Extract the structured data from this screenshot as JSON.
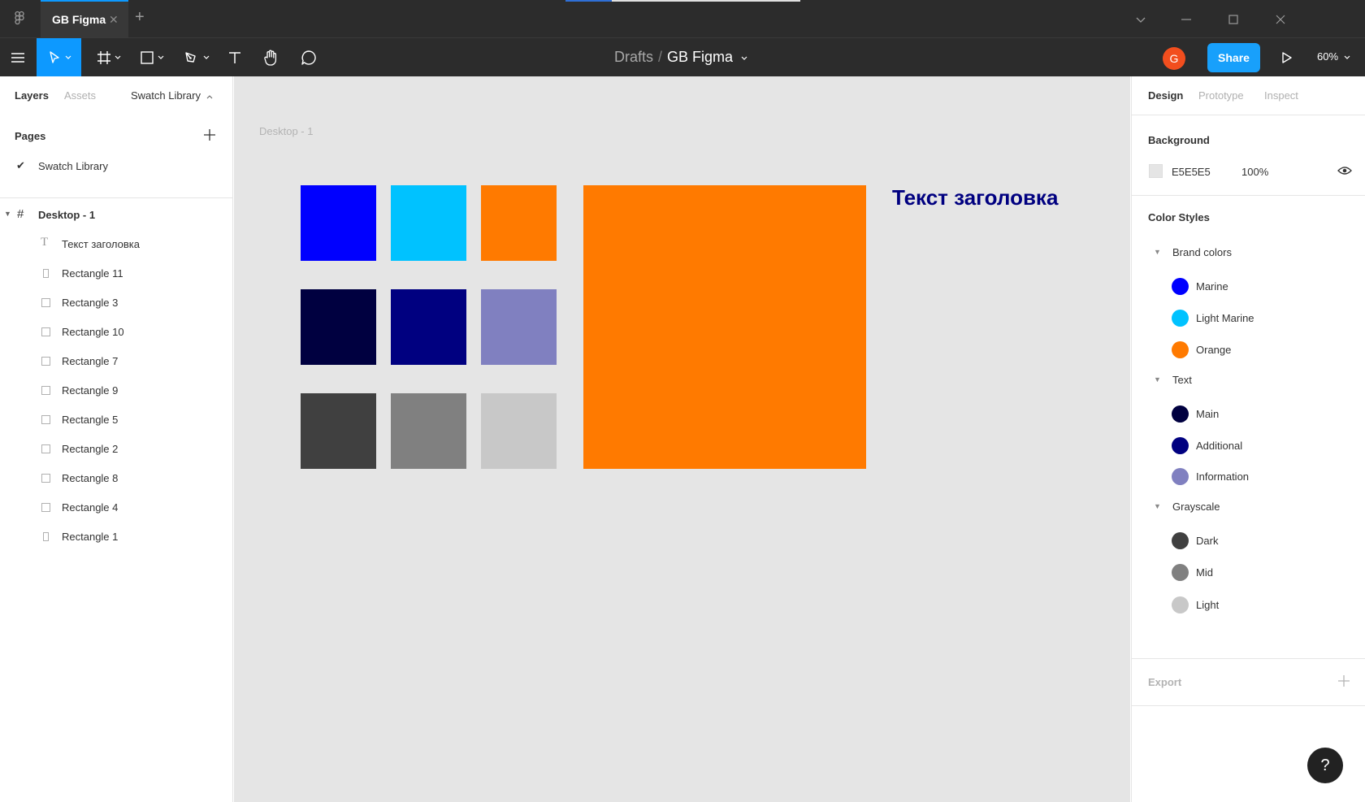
{
  "titlebar": {
    "tab_title": "GB Figma",
    "icons": [
      "figma-logo-icon",
      "close-icon",
      "plus-icon",
      "chevron-down-icon",
      "minimize-icon",
      "maximize-icon",
      "close-window-icon"
    ]
  },
  "toolbar": {
    "breadcrumb_root": "Drafts",
    "breadcrumb_sep": "/",
    "file_name": "GB Figma",
    "avatar_initial": "G",
    "share_label": "Share",
    "zoom_label": "60%",
    "accent_color": "#0d99ff"
  },
  "left_panel": {
    "tabs": [
      "Layers",
      "Assets"
    ],
    "page_selector": "Swatch Library",
    "pages_header": "Pages",
    "pages": [
      {
        "label": "Swatch Library",
        "selected": true
      }
    ],
    "frame_label": "Desktop - 1",
    "layers": [
      {
        "label": "Текст заголовка",
        "icon": "text-icon"
      },
      {
        "label": "Rectangle 11",
        "icon": "rectangle-icon"
      },
      {
        "label": "Rectangle 3",
        "icon": "rectangle-icon"
      },
      {
        "label": "Rectangle 10",
        "icon": "rectangle-icon"
      },
      {
        "label": "Rectangle 7",
        "icon": "rectangle-icon"
      },
      {
        "label": "Rectangle 9",
        "icon": "rectangle-icon"
      },
      {
        "label": "Rectangle 5",
        "icon": "rectangle-icon"
      },
      {
        "label": "Rectangle 2",
        "icon": "rectangle-icon"
      },
      {
        "label": "Rectangle 8",
        "icon": "rectangle-icon"
      },
      {
        "label": "Rectangle 4",
        "icon": "rectangle-icon"
      },
      {
        "label": "Rectangle 1",
        "icon": "rectangle-icon"
      }
    ]
  },
  "canvas": {
    "frame_name": "Desktop - 1",
    "background": "#e5e5e5",
    "heading_text": "Текст заголовка",
    "heading_color": "#000080",
    "swatch_colors": [
      "#0000ff",
      "#00c2ff",
      "#ff7a00",
      "#000040",
      "#000080",
      "#8080c0",
      "#404040",
      "#808080",
      "#c8c8c8"
    ],
    "big_rect_color": "#ff7a00"
  },
  "right_panel": {
    "tabs": [
      "Design",
      "Prototype",
      "Inspect"
    ],
    "background_label": "Background",
    "background_hex": "E5E5E5",
    "background_opacity": "100%",
    "color_styles_label": "Color Styles",
    "groups": [
      {
        "label": "Brand colors",
        "styles": [
          {
            "label": "Marine",
            "color": "#0000ff"
          },
          {
            "label": "Light Marine",
            "color": "#00c2ff"
          },
          {
            "label": "Orange",
            "color": "#ff7a00"
          }
        ]
      },
      {
        "label": "Text",
        "styles": [
          {
            "label": "Main",
            "color": "#000040"
          },
          {
            "label": "Additional",
            "color": "#000080"
          },
          {
            "label": "Information",
            "color": "#8080c0"
          }
        ]
      },
      {
        "label": "Grayscale",
        "styles": [
          {
            "label": "Dark",
            "color": "#404040"
          },
          {
            "label": "Mid",
            "color": "#808080"
          },
          {
            "label": "Light",
            "color": "#c8c8c8"
          }
        ]
      }
    ],
    "export_label": "Export",
    "help_label": "?"
  }
}
